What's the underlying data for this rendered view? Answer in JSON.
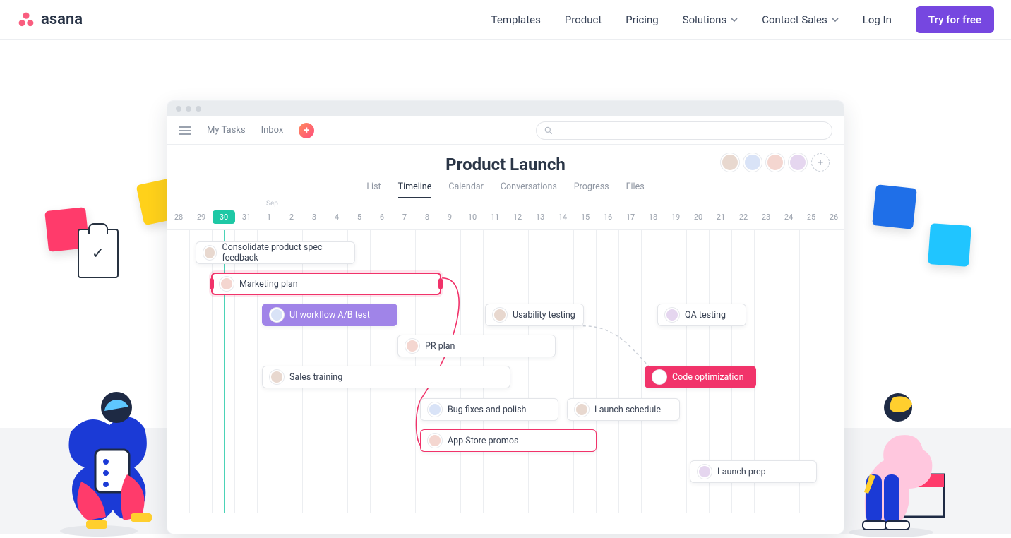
{
  "brand": "asana",
  "nav": {
    "templates": "Templates",
    "product": "Product",
    "pricing": "Pricing",
    "solutions": "Solutions",
    "contact": "Contact Sales",
    "login": "Log In",
    "cta": "Try for free"
  },
  "app": {
    "mytasks": "My Tasks",
    "inbox": "Inbox",
    "search_placeholder": "",
    "title": "Product Launch",
    "tabs": {
      "list": "List",
      "timeline": "Timeline",
      "calendar": "Calendar",
      "conversations": "Conversations",
      "progress": "Progress",
      "files": "Files"
    },
    "month_label": "Sep",
    "days": [
      "28",
      "29",
      "30",
      "31",
      "1",
      "2",
      "3",
      "4",
      "5",
      "6",
      "7",
      "8",
      "9",
      "10",
      "11",
      "12",
      "13",
      "14",
      "15",
      "16",
      "17",
      "18",
      "19",
      "20",
      "21",
      "22",
      "23",
      "24",
      "25",
      "26"
    ],
    "today_index": 2,
    "tasks": {
      "consolidate": "Consolidate product spec feedback",
      "marketing": "Marketing plan",
      "ab": "UI workflow A/B test",
      "usability": "Usability testing",
      "qa": "QA testing",
      "pr": "PR plan",
      "sales": "Sales training",
      "code": "Code optimization",
      "bugs": "Bug fixes and polish",
      "launchsch": "Launch schedule",
      "promos": "App Store promos",
      "launchprep": "Launch prep"
    }
  }
}
